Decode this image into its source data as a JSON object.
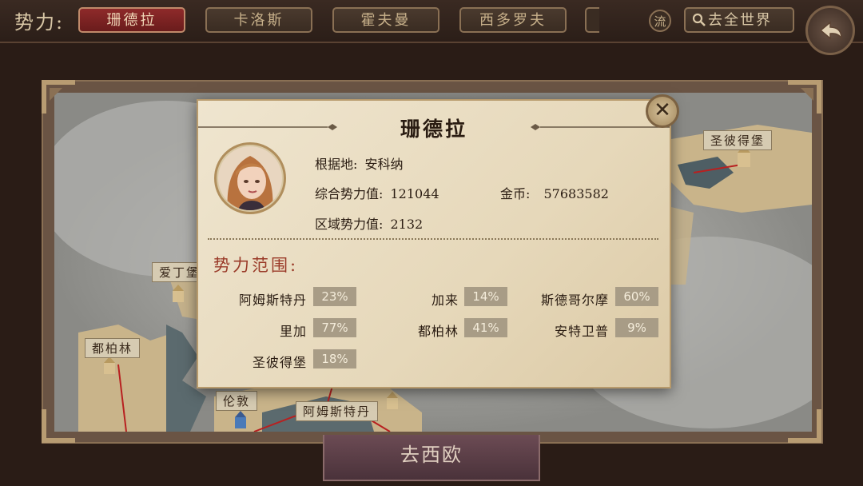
{
  "topbar": {
    "faction_label": "势力:",
    "tabs": [
      {
        "label": "珊德拉",
        "active": true
      },
      {
        "label": "卡洛斯",
        "active": false
      },
      {
        "label": "霍夫曼",
        "active": false
      },
      {
        "label": "西多罗夫",
        "active": false
      }
    ],
    "flow_label": "流",
    "world_button": "去全世界",
    "search_icon": "search-icon",
    "back_icon": "back-arrow-icon"
  },
  "map": {
    "labels": [
      "圣彼得堡",
      "爱丁堡",
      "都柏林",
      "伦敦",
      "阿姆斯特丹"
    ]
  },
  "bottom_button": "去西欧",
  "popup": {
    "title": "珊德拉",
    "base_label": "根据地:",
    "base_value": "安科纳",
    "overall_label": "综合势力值:",
    "overall_value": "121044",
    "gold_label": "金币:",
    "gold_value": "57683582",
    "regional_label": "区域势力值:",
    "regional_value": "2132",
    "range_title": "势力范围:",
    "ranges": [
      {
        "name": "阿姆斯特丹",
        "pct": "23%"
      },
      {
        "name": "加来",
        "pct": "14%"
      },
      {
        "name": "斯德哥尔摩",
        "pct": "60%"
      },
      {
        "name": "里加",
        "pct": "77%"
      },
      {
        "name": "都柏林",
        "pct": "41%"
      },
      {
        "name": "安特卫普",
        "pct": "9%"
      },
      {
        "name": "圣彼得堡",
        "pct": "18%"
      }
    ],
    "close_icon": "close-icon"
  },
  "colors": {
    "active_tab": "#8e2a2a",
    "range_title": "#9a3a28",
    "route": "#b82020"
  }
}
